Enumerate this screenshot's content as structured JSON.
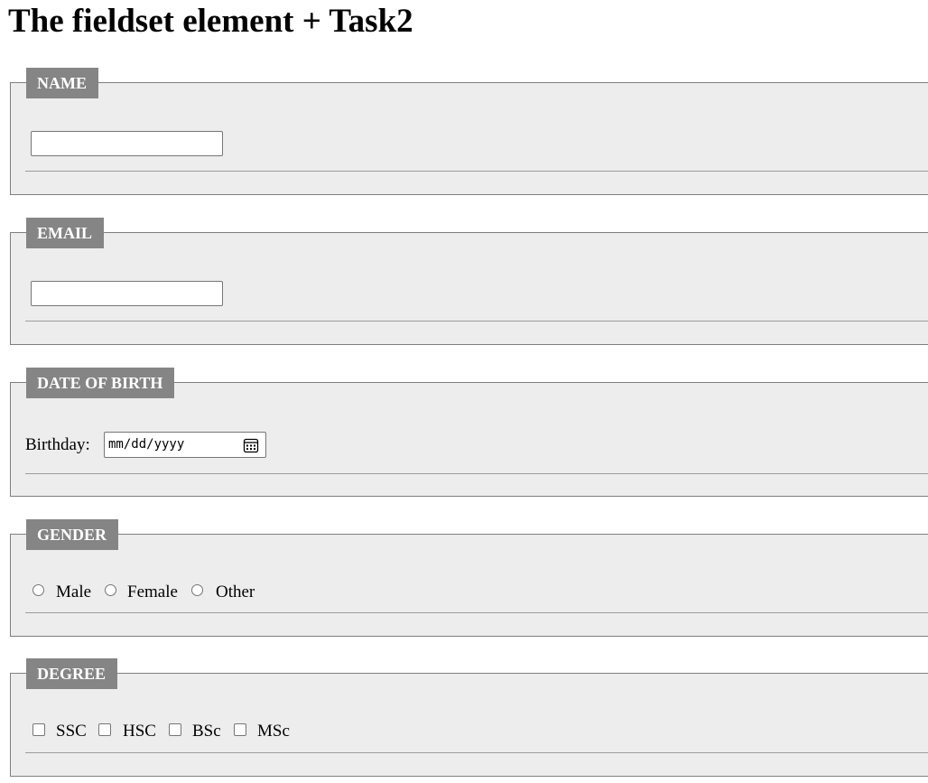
{
  "page": {
    "title": "The fieldset element + Task2"
  },
  "sections": {
    "name": {
      "legend": "NAME",
      "input_value": "",
      "input_placeholder": ""
    },
    "email": {
      "legend": "EMAIL",
      "input_value": "",
      "input_placeholder": ""
    },
    "dob": {
      "legend": "DATE OF BIRTH",
      "label": "Birthday:",
      "date_placeholder": "mm/dd/yyyy"
    },
    "gender": {
      "legend": "GENDER",
      "options": [
        {
          "label": "Male",
          "checked": false
        },
        {
          "label": "Female",
          "checked": false
        },
        {
          "label": "Other",
          "checked": false
        }
      ]
    },
    "degree": {
      "legend": "DEGREE",
      "options": [
        {
          "label": "SSC",
          "checked": false
        },
        {
          "label": "HSC",
          "checked": false
        },
        {
          "label": "BSc",
          "checked": false
        },
        {
          "label": "MSc",
          "checked": false
        }
      ]
    }
  },
  "icons": {
    "calendar": "calendar-icon"
  },
  "colors": {
    "fieldset_background": "#ededed",
    "legend_background": "#858585",
    "legend_text": "#ffffff",
    "border": "#7f7f7f"
  }
}
